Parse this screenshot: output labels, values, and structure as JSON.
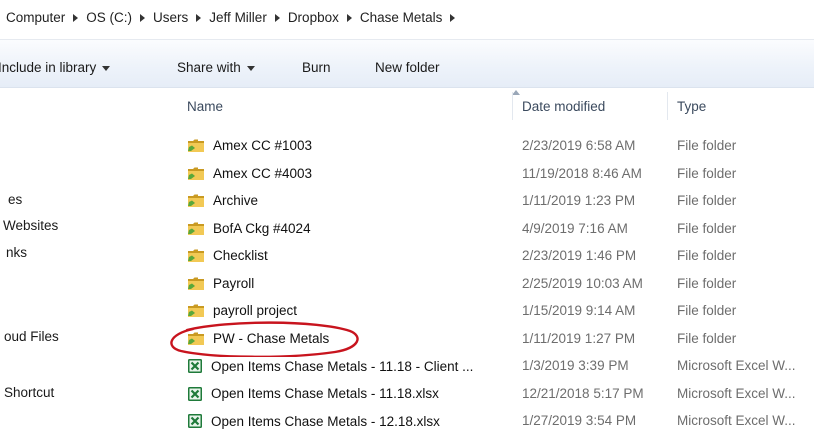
{
  "breadcrumb": {
    "items": [
      "Computer",
      "OS (C:)",
      "Users",
      "Jeff Miller",
      "Dropbox",
      "Chase Metals"
    ]
  },
  "toolbar": {
    "include_in_library": "Include in library",
    "share_with": "Share with",
    "burn": "Burn",
    "new_folder": "New folder"
  },
  "nav_pane": {
    "items": [
      "es",
      "Websites",
      "nks",
      "oud Files",
      "Shortcut"
    ]
  },
  "columns": {
    "name": "Name",
    "date_modified": "Date modified",
    "type": "Type"
  },
  "files": [
    {
      "name": "Amex CC #1003",
      "date": "2/23/2019 6:58 AM",
      "type": "File folder",
      "icon": "folder-icon"
    },
    {
      "name": "Amex CC #4003",
      "date": "11/19/2018 8:46 AM",
      "type": "File folder",
      "icon": "folder-icon"
    },
    {
      "name": "Archive",
      "date": "1/11/2019 1:23 PM",
      "type": "File folder",
      "icon": "folder-icon"
    },
    {
      "name": "BofA Ckg #4024",
      "date": "4/9/2019 7:16 AM",
      "type": "File folder",
      "icon": "folder-icon"
    },
    {
      "name": "Checklist",
      "date": "2/23/2019 1:46 PM",
      "type": "File folder",
      "icon": "folder-icon"
    },
    {
      "name": "Payroll",
      "date": "2/25/2019 10:03 AM",
      "type": "File folder",
      "icon": "folder-icon"
    },
    {
      "name": "payroll project",
      "date": "1/15/2019 9:14 AM",
      "type": "File folder",
      "icon": "folder-icon"
    },
    {
      "name": "PW - Chase Metals",
      "date": "1/11/2019 1:27 PM",
      "type": "File folder",
      "icon": "folder-icon"
    },
    {
      "name": "Open Items Chase Metals - 11.18 - Client ...",
      "date": "1/3/2019 3:39 PM",
      "type": "Microsoft Excel W...",
      "icon": "excel-icon"
    },
    {
      "name": "Open Items Chase Metals - 11.18.xlsx",
      "date": "12/21/2018 5:17 PM",
      "type": "Microsoft Excel W...",
      "icon": "excel-icon"
    },
    {
      "name": "Open Items Chase Metals - 12.18.xlsx",
      "date": "1/27/2019 3:54 PM",
      "type": "Microsoft Excel W...",
      "icon": "excel-icon"
    }
  ],
  "colors": {
    "annotation_circle": "#c8141e",
    "toolbar_bg": "#e6edf7",
    "header_text": "#3b4a5e"
  }
}
